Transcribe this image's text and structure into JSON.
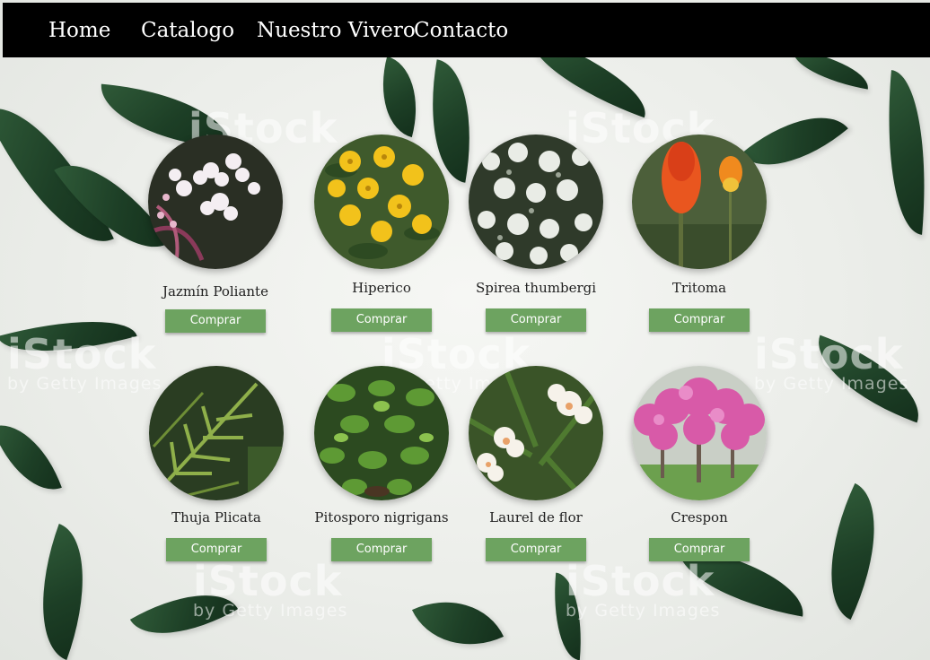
{
  "nav": {
    "items": [
      {
        "label": "Home"
      },
      {
        "label": "Catalogo"
      },
      {
        "label": "Nuestro Vivero"
      },
      {
        "label": "Contacto"
      }
    ]
  },
  "watermark": {
    "logo": "iStock",
    "sub": "by Getty Images"
  },
  "catalog": {
    "buy_label": "Comprar",
    "products": [
      {
        "name": "Jazmín Poliante",
        "image": "jasmine-flowers-photo"
      },
      {
        "name": "Hiperico",
        "image": "yellow-hypericum-photo"
      },
      {
        "name": "Spirea thumbergi",
        "image": "white-spirea-photo"
      },
      {
        "name": "Tritoma",
        "image": "red-hot-poker-photo"
      },
      {
        "name": "Thuja Plicata",
        "image": "thuja-foliage-photo"
      },
      {
        "name": "Pitosporo nigrigans",
        "image": "pittosporum-shrub-photo"
      },
      {
        "name": "Laurel de flor",
        "image": "oleander-flowers-photo"
      },
      {
        "name": "Crespon",
        "image": "crape-myrtle-tree-photo"
      }
    ]
  },
  "colors": {
    "navbar": "#000000",
    "button": "#6da360",
    "leaf": "#1d3f26"
  }
}
